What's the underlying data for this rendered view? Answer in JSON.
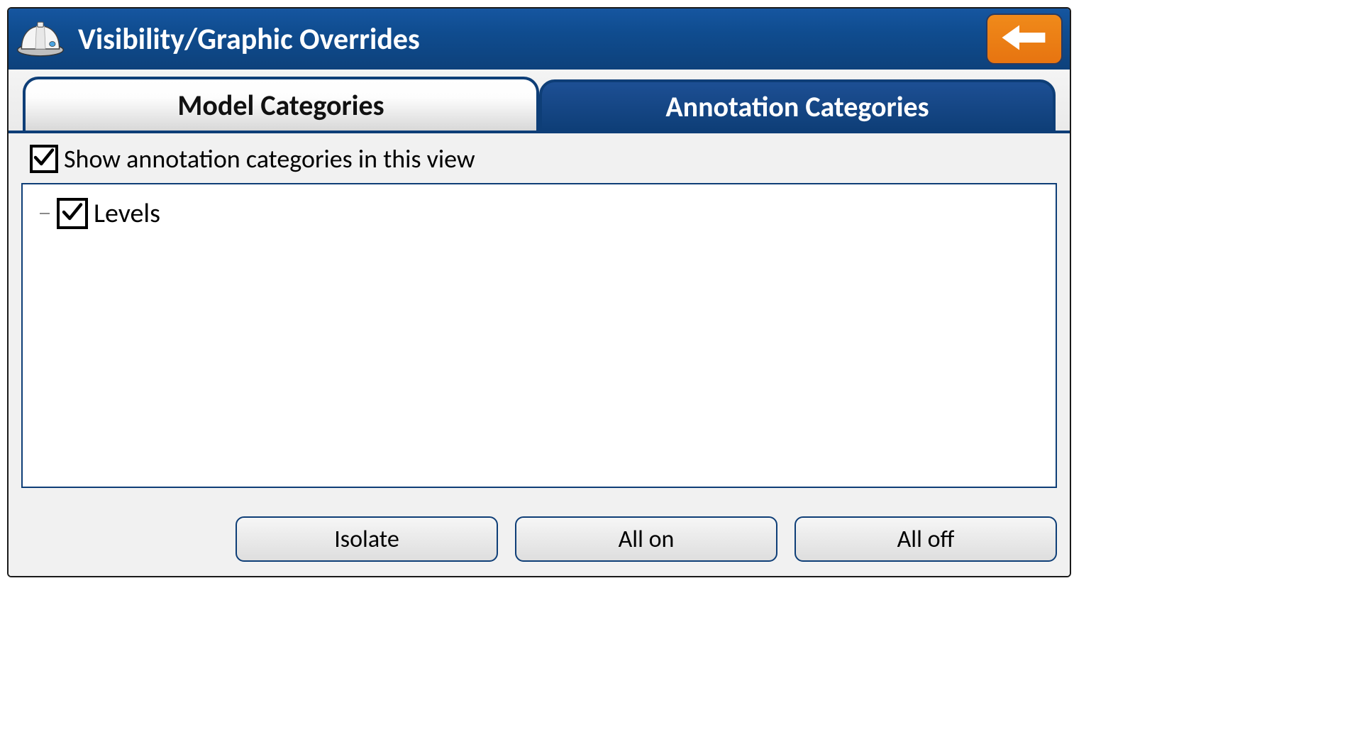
{
  "header": {
    "title": "Visibility/Graphic Overrides"
  },
  "tabs": {
    "model": "Model Categories",
    "annotation": "Annotation Categories",
    "active": "annotation"
  },
  "show_toggle": {
    "label": "Show annotation categories in this view",
    "checked": true
  },
  "categories": [
    {
      "label": "Levels",
      "checked": true
    }
  ],
  "buttons": {
    "isolate": "Isolate",
    "all_on": "All on",
    "all_off": "All off"
  },
  "icons": {
    "app": "hardhat-icon",
    "back": "arrow-left-icon",
    "check": "checkmark-icon"
  }
}
